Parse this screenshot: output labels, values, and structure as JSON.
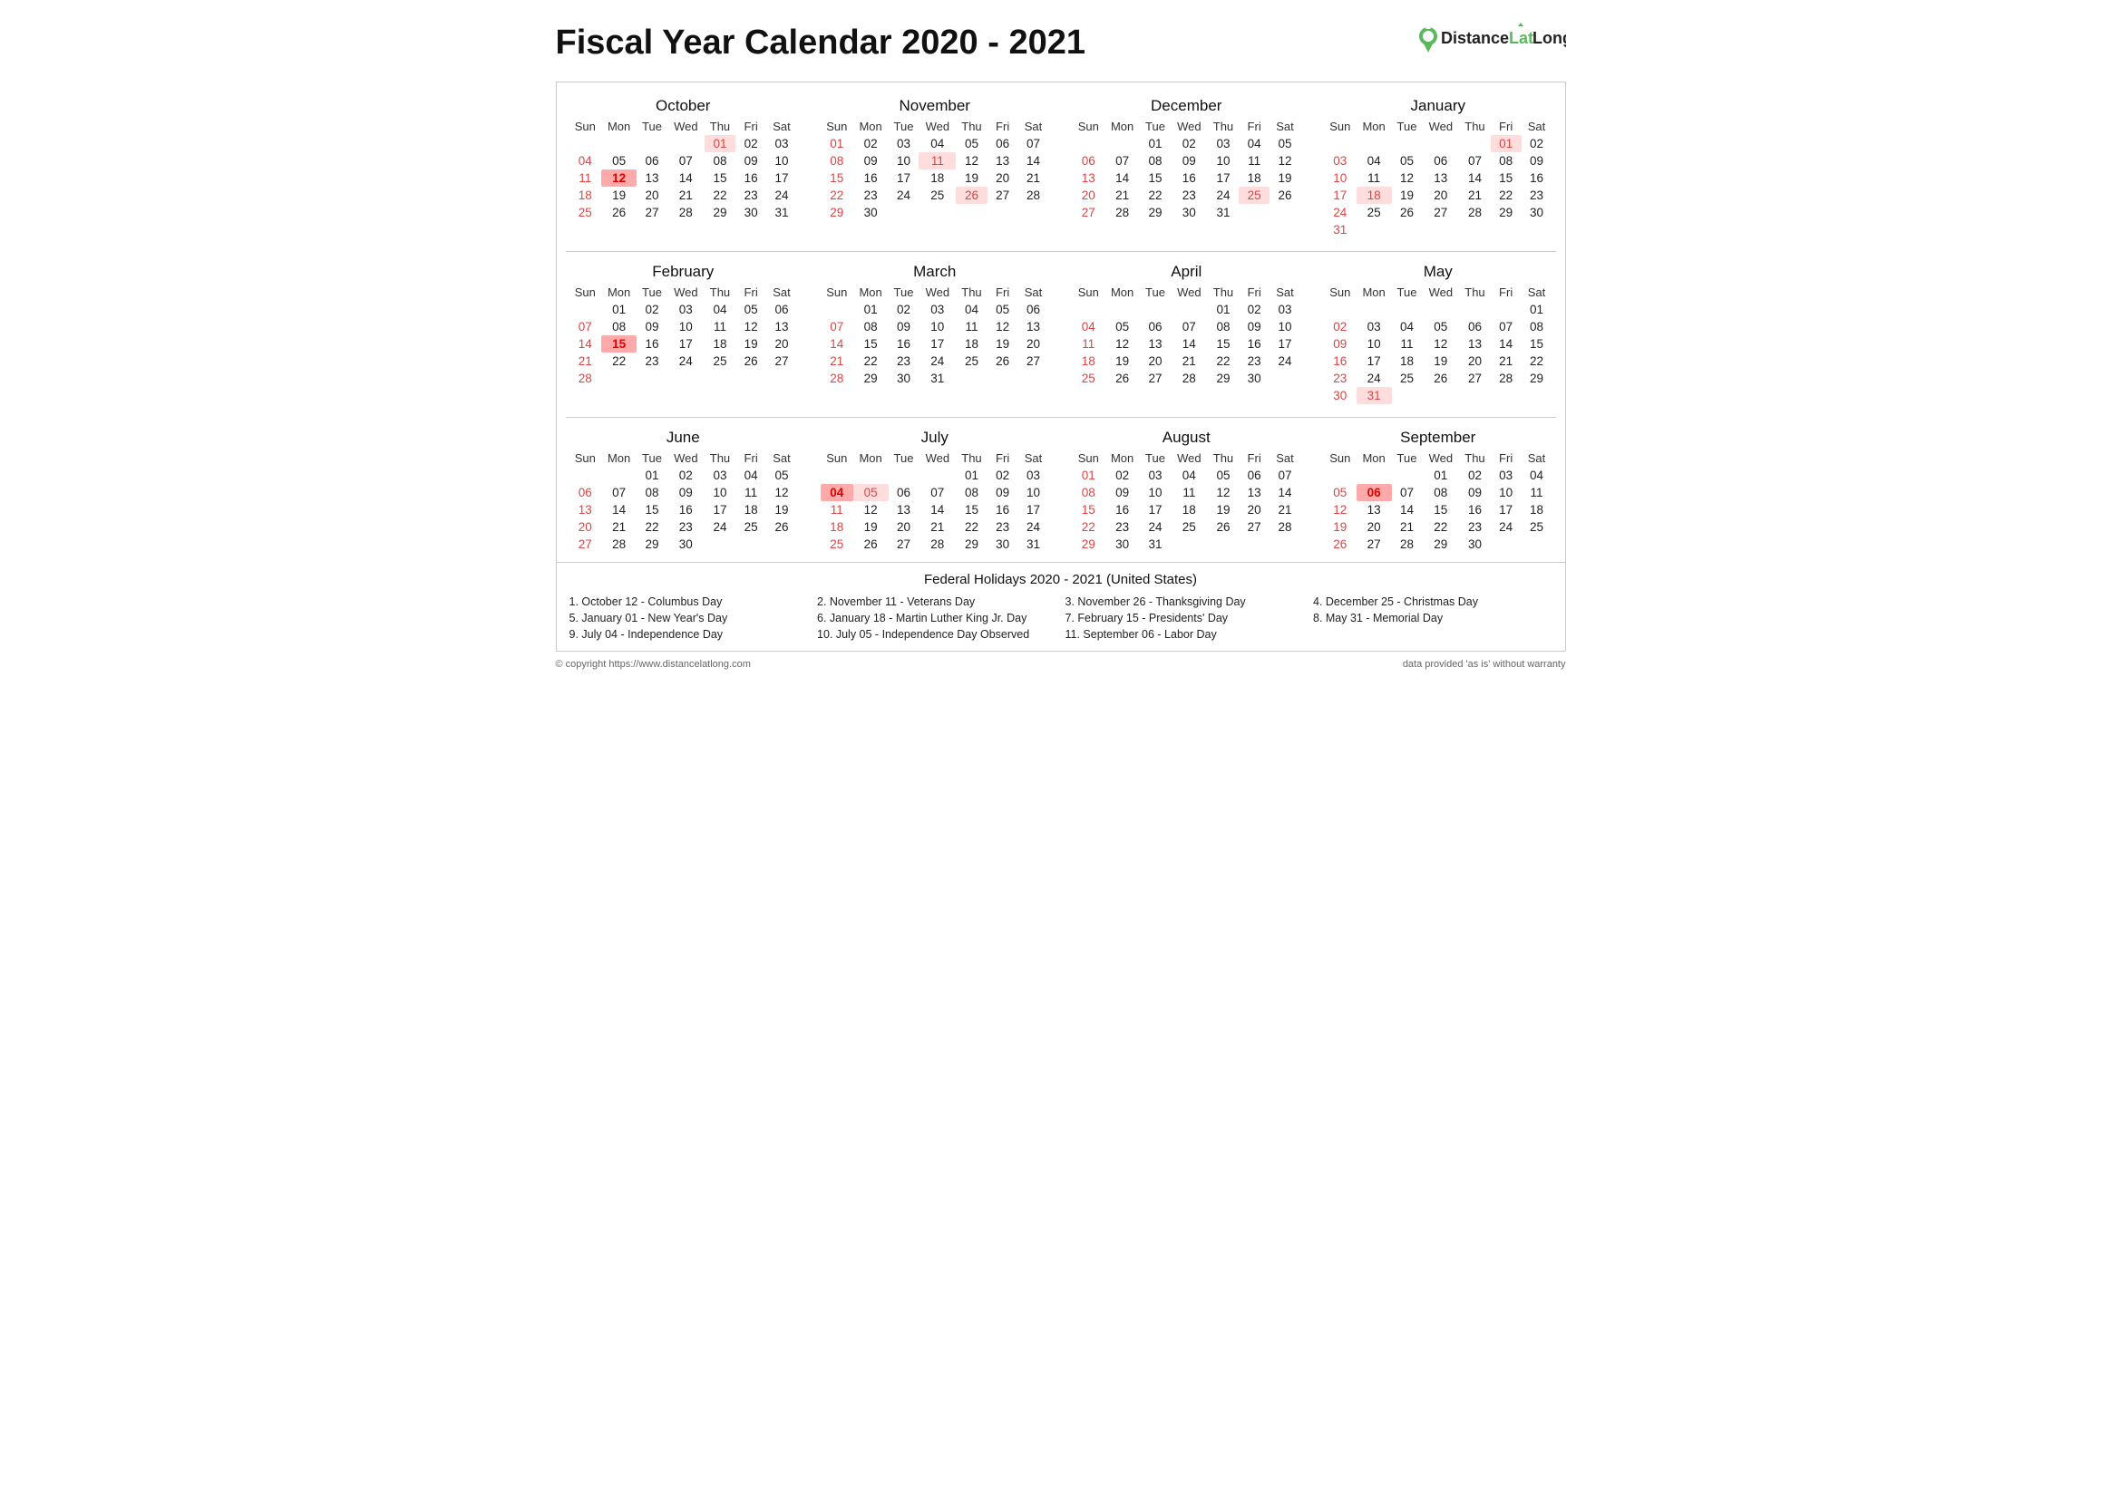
{
  "title": "Fiscal Year Calendar 2020 - 2021",
  "logo": {
    "text": "DistanceLatLong",
    "url_text": "https://www.distancelatlong.com"
  },
  "months": [
    {
      "name": "October",
      "days_header": [
        "Sun",
        "Mon",
        "Tue",
        "Wed",
        "Thu",
        "Fri",
        "Sat"
      ],
      "weeks": [
        [
          null,
          null,
          null,
          null,
          "01",
          "02",
          "03"
        ],
        [
          "04",
          "05",
          "06",
          "07",
          "08",
          "09",
          "10"
        ],
        [
          "11",
          "12",
          "13",
          "14",
          "15",
          "16",
          "17"
        ],
        [
          "18",
          "19",
          "20",
          "21",
          "22",
          "23",
          "24"
        ],
        [
          "25",
          "26",
          "27",
          "28",
          "29",
          "30",
          "31"
        ]
      ],
      "sundays": [
        "04",
        "11",
        "18",
        "25"
      ],
      "holidays": [
        "01"
      ],
      "holiday_boxes": [
        "12"
      ]
    },
    {
      "name": "November",
      "days_header": [
        "Sun",
        "Mon",
        "Tue",
        "Wed",
        "Thu",
        "Fri",
        "Sat"
      ],
      "weeks": [
        [
          "01",
          "02",
          "03",
          "04",
          "05",
          "06",
          "07"
        ],
        [
          "08",
          "09",
          "10",
          "11",
          "12",
          "13",
          "14"
        ],
        [
          "15",
          "16",
          "17",
          "18",
          "19",
          "20",
          "21"
        ],
        [
          "22",
          "23",
          "24",
          "25",
          "26",
          "27",
          "28"
        ],
        [
          "29",
          "30",
          null,
          null,
          null,
          null,
          null
        ]
      ],
      "sundays": [
        "01",
        "08",
        "15",
        "22",
        "29"
      ],
      "holidays": [
        "11",
        "26"
      ],
      "holiday_boxes": []
    },
    {
      "name": "December",
      "days_header": [
        "Sun",
        "Mon",
        "Tue",
        "Wed",
        "Thu",
        "Fri",
        "Sat"
      ],
      "weeks": [
        [
          null,
          null,
          "01",
          "02",
          "03",
          "04",
          "05"
        ],
        [
          "06",
          "07",
          "08",
          "09",
          "10",
          "11",
          "12"
        ],
        [
          "13",
          "14",
          "15",
          "16",
          "17",
          "18",
          "19"
        ],
        [
          "20",
          "21",
          "22",
          "23",
          "24",
          "25",
          "26"
        ],
        [
          "27",
          "28",
          "29",
          "30",
          "31",
          null,
          null
        ]
      ],
      "sundays": [
        "06",
        "13",
        "20",
        "27"
      ],
      "holidays": [
        "25"
      ],
      "holiday_boxes": []
    },
    {
      "name": "January",
      "days_header": [
        "Sun",
        "Mon",
        "Tue",
        "Wed",
        "Thu",
        "Fri",
        "Sat"
      ],
      "weeks": [
        [
          null,
          null,
          null,
          null,
          null,
          "01",
          "02"
        ],
        [
          "03",
          "04",
          "05",
          "06",
          "07",
          "08",
          "09"
        ],
        [
          "10",
          "11",
          "12",
          "13",
          "14",
          "15",
          "16"
        ],
        [
          "17",
          "18",
          "19",
          "20",
          "21",
          "22",
          "23"
        ],
        [
          "24",
          "25",
          "26",
          "27",
          "28",
          "29",
          "30"
        ],
        [
          "31",
          null,
          null,
          null,
          null,
          null,
          null
        ]
      ],
      "sundays": [
        "03",
        "10",
        "17",
        "24",
        "31"
      ],
      "holidays": [
        "01",
        "18"
      ],
      "holiday_boxes": []
    },
    {
      "name": "February",
      "days_header": [
        "Sun",
        "Mon",
        "Tue",
        "Wed",
        "Thu",
        "Fri",
        "Sat"
      ],
      "weeks": [
        [
          null,
          "01",
          "02",
          "03",
          "04",
          "05",
          "06"
        ],
        [
          "07",
          "08",
          "09",
          "10",
          "11",
          "12",
          "13"
        ],
        [
          "14",
          "15",
          "16",
          "17",
          "18",
          "19",
          "20"
        ],
        [
          "21",
          "22",
          "23",
          "24",
          "25",
          "26",
          "27"
        ],
        [
          "28",
          null,
          null,
          null,
          null,
          null,
          null
        ]
      ],
      "sundays": [
        "07",
        "14",
        "21",
        "28"
      ],
      "holidays": [
        "15"
      ],
      "holiday_boxes": [
        "15"
      ]
    },
    {
      "name": "March",
      "days_header": [
        "Sun",
        "Mon",
        "Tue",
        "Wed",
        "Thu",
        "Fri",
        "Sat"
      ],
      "weeks": [
        [
          null,
          "01",
          "02",
          "03",
          "04",
          "05",
          "06"
        ],
        [
          "07",
          "08",
          "09",
          "10",
          "11",
          "12",
          "13"
        ],
        [
          "14",
          "15",
          "16",
          "17",
          "18",
          "19",
          "20"
        ],
        [
          "21",
          "22",
          "23",
          "24",
          "25",
          "26",
          "27"
        ],
        [
          "28",
          "29",
          "30",
          "31",
          null,
          null,
          null
        ]
      ],
      "sundays": [
        "07",
        "14",
        "21",
        "28"
      ],
      "holidays": [],
      "holiday_boxes": []
    },
    {
      "name": "April",
      "days_header": [
        "Sun",
        "Mon",
        "Tue",
        "Wed",
        "Thu",
        "Fri",
        "Sat"
      ],
      "weeks": [
        [
          null,
          null,
          null,
          null,
          "01",
          "02",
          "03"
        ],
        [
          "04",
          "05",
          "06",
          "07",
          "08",
          "09",
          "10"
        ],
        [
          "11",
          "12",
          "13",
          "14",
          "15",
          "16",
          "17"
        ],
        [
          "18",
          "19",
          "20",
          "21",
          "22",
          "23",
          "24"
        ],
        [
          "25",
          "26",
          "27",
          "28",
          "29",
          "30",
          null
        ]
      ],
      "sundays": [
        "04",
        "11",
        "18",
        "25"
      ],
      "holidays": [],
      "holiday_boxes": []
    },
    {
      "name": "May",
      "days_header": [
        "Sun",
        "Mon",
        "Tue",
        "Wed",
        "Thu",
        "Fri",
        "Sat"
      ],
      "weeks": [
        [
          null,
          null,
          null,
          null,
          null,
          null,
          "01"
        ],
        [
          "02",
          "03",
          "04",
          "05",
          "06",
          "07",
          "08"
        ],
        [
          "09",
          "10",
          "11",
          "12",
          "13",
          "14",
          "15"
        ],
        [
          "16",
          "17",
          "18",
          "19",
          "20",
          "21",
          "22"
        ],
        [
          "23",
          "24",
          "25",
          "26",
          "27",
          "28",
          "29"
        ],
        [
          "30",
          "31",
          null,
          null,
          null,
          null,
          null
        ]
      ],
      "sundays": [
        "02",
        "09",
        "16",
        "23",
        "30"
      ],
      "holidays": [
        "31"
      ],
      "holiday_boxes": []
    },
    {
      "name": "June",
      "days_header": [
        "Sun",
        "Mon",
        "Tue",
        "Wed",
        "Thu",
        "Fri",
        "Sat"
      ],
      "weeks": [
        [
          null,
          null,
          "01",
          "02",
          "03",
          "04",
          "05"
        ],
        [
          "06",
          "07",
          "08",
          "09",
          "10",
          "11",
          "12"
        ],
        [
          "13",
          "14",
          "15",
          "16",
          "17",
          "18",
          "19"
        ],
        [
          "20",
          "21",
          "22",
          "23",
          "24",
          "25",
          "26"
        ],
        [
          "27",
          "28",
          "29",
          "30",
          null,
          null,
          null
        ]
      ],
      "sundays": [
        "06",
        "13",
        "20",
        "27"
      ],
      "holidays": [],
      "holiday_boxes": []
    },
    {
      "name": "July",
      "days_header": [
        "Sun",
        "Mon",
        "Tue",
        "Wed",
        "Thu",
        "Fri",
        "Sat"
      ],
      "weeks": [
        [
          null,
          null,
          null,
          null,
          "01",
          "02",
          "03"
        ],
        [
          "04",
          "05",
          "06",
          "07",
          "08",
          "09",
          "10"
        ],
        [
          "11",
          "12",
          "13",
          "14",
          "15",
          "16",
          "17"
        ],
        [
          "18",
          "19",
          "20",
          "21",
          "22",
          "23",
          "24"
        ],
        [
          "25",
          "26",
          "27",
          "28",
          "29",
          "30",
          "31"
        ]
      ],
      "sundays": [
        "04",
        "11",
        "18",
        "25"
      ],
      "holidays": [
        "04",
        "05"
      ],
      "holiday_boxes": [
        "04"
      ]
    },
    {
      "name": "August",
      "days_header": [
        "Sun",
        "Mon",
        "Tue",
        "Wed",
        "Thu",
        "Fri",
        "Sat"
      ],
      "weeks": [
        [
          "01",
          "02",
          "03",
          "04",
          "05",
          "06",
          "07"
        ],
        [
          "08",
          "09",
          "10",
          "11",
          "12",
          "13",
          "14"
        ],
        [
          "15",
          "16",
          "17",
          "18",
          "19",
          "20",
          "21"
        ],
        [
          "22",
          "23",
          "24",
          "25",
          "26",
          "27",
          "28"
        ],
        [
          "29",
          "30",
          "31",
          null,
          null,
          null,
          null
        ]
      ],
      "sundays": [
        "01",
        "08",
        "15",
        "22",
        "29"
      ],
      "holidays": [],
      "holiday_boxes": []
    },
    {
      "name": "September",
      "days_header": [
        "Sun",
        "Mon",
        "Tue",
        "Wed",
        "Thu",
        "Fri",
        "Sat"
      ],
      "weeks": [
        [
          null,
          null,
          null,
          "01",
          "02",
          "03",
          "04"
        ],
        [
          "05",
          "06",
          "07",
          "08",
          "09",
          "10",
          "11"
        ],
        [
          "12",
          "13",
          "14",
          "15",
          "16",
          "17",
          "18"
        ],
        [
          "19",
          "20",
          "21",
          "22",
          "23",
          "24",
          "25"
        ],
        [
          "26",
          "27",
          "28",
          "29",
          "30",
          null,
          null
        ]
      ],
      "sundays": [
        "05",
        "12",
        "19",
        "26"
      ],
      "holidays": [
        "06"
      ],
      "holiday_boxes": [
        "06"
      ]
    }
  ],
  "holidays_section": {
    "title": "Federal Holidays 2020 - 2021 (United States)",
    "items": [
      "1. October 12 - Columbus Day",
      "2. November 11 - Veterans Day",
      "3. November 26 - Thanksgiving Day",
      "4. December 25 - Christmas Day",
      "5. January 01 - New Year's Day",
      "6. January 18 - Martin Luther King Jr. Day",
      "7. February 15 - Presidents' Day",
      "8. May 31 - Memorial Day",
      "9. July 04 - Independence Day",
      "10. July 05 - Independence Day Observed",
      "11. September 06 - Labor Day",
      ""
    ]
  },
  "footer": {
    "left": "© copyright https://www.distancelatlong.com",
    "right": "data provided 'as is' without warranty"
  }
}
